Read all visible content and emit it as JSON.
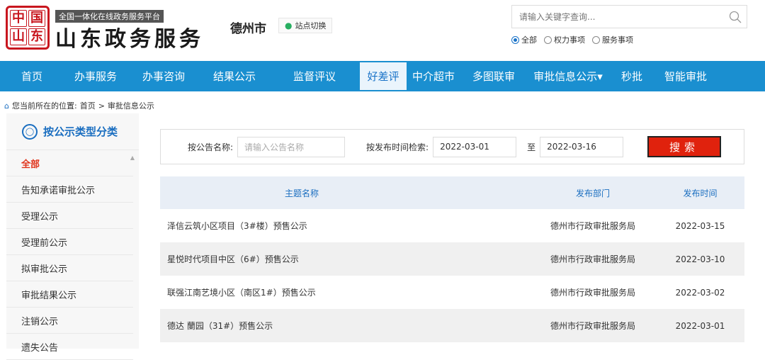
{
  "header": {
    "logo_chars": [
      "中",
      "国",
      "山",
      "东"
    ],
    "slogan": "全国一体化在线政务服务平台",
    "brand": "山东政务服务",
    "city": "德州市",
    "site_switch": "站点切换",
    "search_placeholder": "请输入关键字查询...",
    "scope_options": [
      "全部",
      "权力事项",
      "服务事项"
    ]
  },
  "nav": {
    "items": [
      "首页",
      "办事服务",
      "办事咨询",
      "结果公示",
      "监督评议",
      "好差评",
      "中介超市",
      "多图联审",
      "审批信息公示▾",
      "秒批",
      "智能审批"
    ],
    "active_index": 5
  },
  "breadcrumb": {
    "prefix": "您当前所在的位置:",
    "home": "首页",
    "sep": ">",
    "current": "审批信息公示"
  },
  "sidebar": {
    "title": "按公示类型分类",
    "items": [
      "全部",
      "告知承诺审批公示",
      "受理公示",
      "受理前公示",
      "拟审批公示",
      "审批结果公示",
      "注销公示",
      "遗失公告"
    ],
    "active_index": 0
  },
  "filter": {
    "name_label": "按公告名称:",
    "name_placeholder": "请输入公告名称",
    "date_label": "按发布时间检索:",
    "date_from": "2022-03-01",
    "to_label": "至",
    "date_to": "2022-03-16",
    "search_button": "搜索"
  },
  "table": {
    "headers": [
      "主题名称",
      "发布部门",
      "发布时间"
    ],
    "rows": [
      [
        "泽信云筑小区项目（3#楼）预售公示",
        "德州市行政审批服务局",
        "2022-03-15"
      ],
      [
        "星悦时代项目中区（6#）预售公示",
        "德州市行政审批服务局",
        "2022-03-10"
      ],
      [
        "联强江南艺境小区（南区1#）预售公示",
        "德州市行政审批服务局",
        "2022-03-02"
      ],
      [
        "德达 蘭园（31#）预售公示",
        "德州市行政审批服务局",
        "2022-03-01"
      ]
    ]
  },
  "colors": {
    "nav_bg": "#1a8fd0",
    "accent_red": "#e0220d",
    "link_blue": "#1a6ec0"
  }
}
